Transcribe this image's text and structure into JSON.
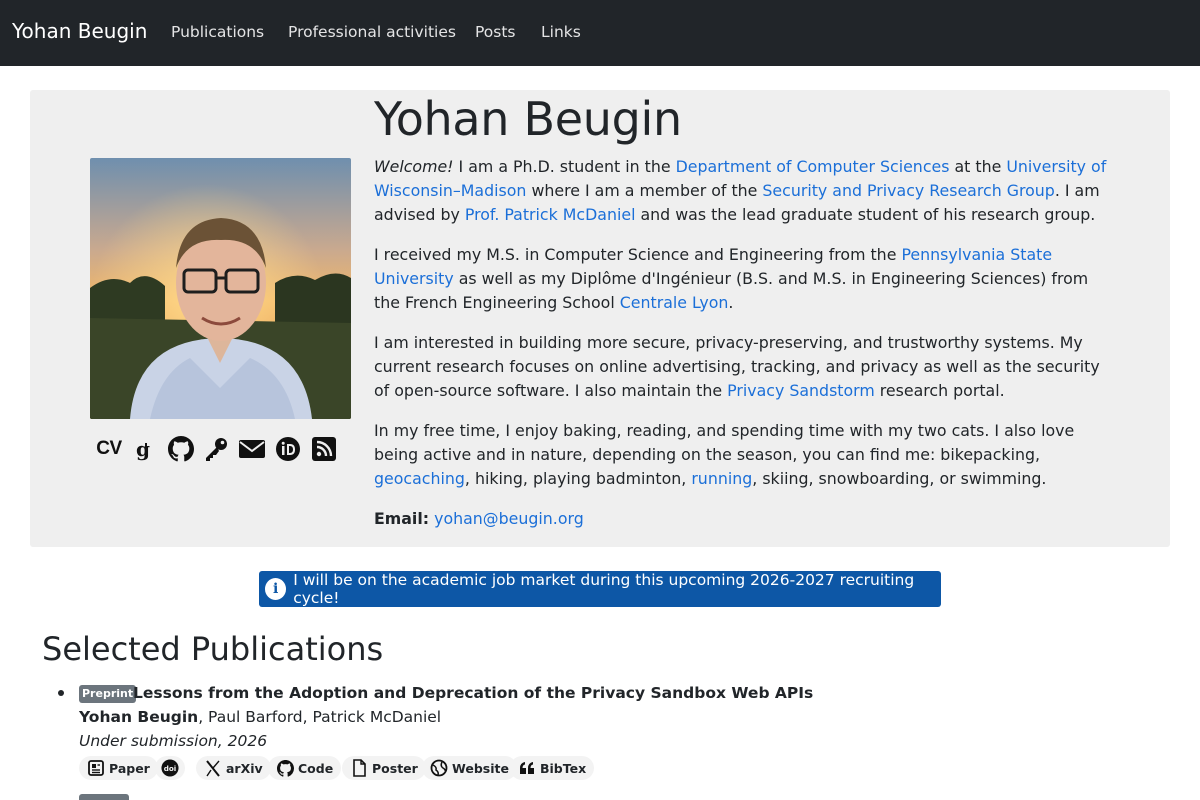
{
  "nav": {
    "brand": "Yohan Beugin",
    "items": [
      "Publications",
      "Professional activities",
      "Posts",
      "Links"
    ]
  },
  "profile": {
    "name": "Yohan Beugin",
    "icons": [
      "cv-icon",
      "google-scholar-icon",
      "github-icon",
      "key-icon",
      "envelope-icon",
      "orcid-icon",
      "rss-icon"
    ],
    "cv_label": "CV",
    "bio": {
      "p1": {
        "welcome": "Welcome!",
        "t1": " I am a Ph.D. student in the ",
        "l1": "Department of Computer Sciences",
        "t2": " at the ",
        "l2": "University of Wisconsin–Madison",
        "t3": " where I am a member of the ",
        "l3": "Security and Privacy Research Group",
        "t4": ". I am advised by ",
        "l4": "Prof. Patrick McDaniel",
        "t5": " and was the lead graduate student of his research group."
      },
      "p2": {
        "t1": "I received my M.S. in Computer Science and Engineering from the ",
        "l1": "Pennsylvania State University",
        "t2": " as well as my Diplôme d'Ingénieur (B.S. and M.S. in Engineering Sciences) from the French Engineering School ",
        "l2": "Centrale Lyon",
        "t3": "."
      },
      "p3": {
        "t1": "I am interested in building more secure, privacy-preserving, and trustworthy systems. My current research focuses on online advertising, tracking, and privacy as well as the security of open-source software. I also maintain the ",
        "l1": "Privacy Sandstorm",
        "t2": " research portal."
      },
      "p4": {
        "t1": "In my free time, I enjoy baking, reading, and spending time with my two cats. I also love being active and in nature, depending on the season, you can find me: bikepacking, ",
        "l1": "geocaching",
        "t2": ", hiking, playing badminton, ",
        "l2": "running",
        "t3": ", skiing, snowboarding, or swimming."
      },
      "email_label": "Email:",
      "email": "yohan@beugin.org"
    }
  },
  "alert": {
    "icon": "info-circle-icon",
    "text": "I will be on the academic job market during this upcoming 2026-2027 recruiting cycle!"
  },
  "publications": {
    "title": "Selected Publications",
    "items": [
      {
        "badge": "Preprint",
        "title": "Lessons from the Adoption and Deprecation of the Privacy Sandbox Web APIs",
        "first_author": "Yohan Beugin",
        "other_authors": ", Paul Barford, Patrick McDaniel",
        "venue": "Under submission, 2026",
        "links": [
          {
            "icon": "paper-icon",
            "label": "Paper"
          },
          {
            "icon": "doi-icon",
            "label": ""
          },
          {
            "icon": "arxiv-icon",
            "label": "arXiv"
          },
          {
            "icon": "github-icon",
            "label": "Code"
          },
          {
            "icon": "file-icon",
            "label": "Poster"
          },
          {
            "icon": "globe-icon",
            "label": "Website"
          },
          {
            "icon": "quote-icon",
            "label": "BibTex"
          }
        ]
      }
    ]
  },
  "colors": {
    "navbar": "#212529",
    "hero_bg": "#efefef",
    "link": "#1b6fd8",
    "alert": "#0d57a6",
    "badge": "#6c757d"
  }
}
